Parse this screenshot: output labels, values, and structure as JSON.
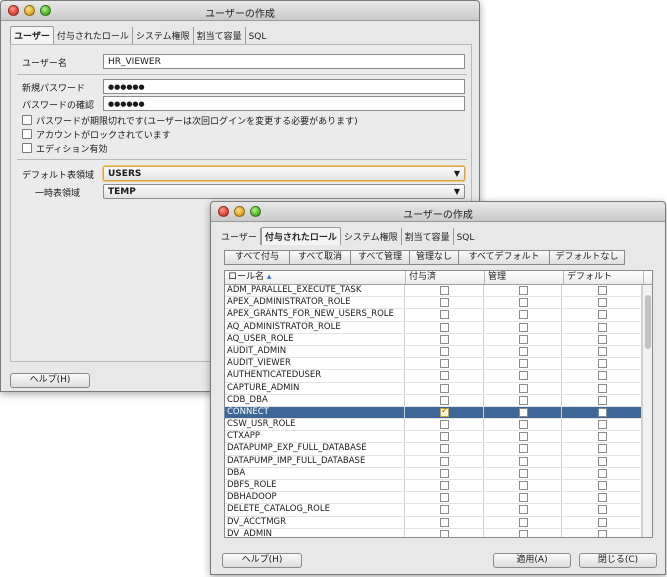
{
  "back_window": {
    "title": "ユーザーの作成",
    "tabs": [
      "ユーザー",
      "付与されたロール",
      "システム権限",
      "割当て容量",
      "SQL"
    ],
    "active_tab": 0,
    "username_label": "ユーザー名",
    "username_value": "HR_VIEWER",
    "new_password_label": "新規パスワード",
    "new_password_value": "●●●●●●",
    "confirm_password_label": "パスワードの確認",
    "confirm_password_value": "●●●●●●",
    "check_expired": "パスワードが期限切れです(ユーザーは次回ログインを変更する必要があります)",
    "check_locked": "アカウントがロックされています",
    "check_edition": "エディション有効",
    "default_ts_label": "デフォルト表領域",
    "default_ts_value": "USERS",
    "temp_ts_label": "一時表領域",
    "temp_ts_value": "TEMP",
    "help_button": "ヘルプ(H)"
  },
  "front_window": {
    "title": "ユーザーの作成",
    "tabs": [
      "ユーザー",
      "付与されたロール",
      "システム権限",
      "割当て容量",
      "SQL"
    ],
    "active_tab": 1,
    "toolbar": [
      "すべて付与",
      "すべて取消",
      "すべて管理",
      "管理なし",
      "すべてデフォルト",
      "デフォルトなし"
    ],
    "columns": [
      "ロール名",
      "付与済",
      "管理",
      "デフォルト"
    ],
    "sort_icon": "sort-ascending-icon",
    "rows": [
      {
        "name": "ADM_PARALLEL_EXECUTE_TASK",
        "granted": false,
        "admin": false,
        "default": false
      },
      {
        "name": "APEX_ADMINISTRATOR_ROLE",
        "granted": false,
        "admin": false,
        "default": false
      },
      {
        "name": "APEX_GRANTS_FOR_NEW_USERS_ROLE",
        "granted": false,
        "admin": false,
        "default": false
      },
      {
        "name": "AQ_ADMINISTRATOR_ROLE",
        "granted": false,
        "admin": false,
        "default": false
      },
      {
        "name": "AQ_USER_ROLE",
        "granted": false,
        "admin": false,
        "default": false
      },
      {
        "name": "AUDIT_ADMIN",
        "granted": false,
        "admin": false,
        "default": false
      },
      {
        "name": "AUDIT_VIEWER",
        "granted": false,
        "admin": false,
        "default": false
      },
      {
        "name": "AUTHENTICATEDUSER",
        "granted": false,
        "admin": false,
        "default": false
      },
      {
        "name": "CAPTURE_ADMIN",
        "granted": false,
        "admin": false,
        "default": false
      },
      {
        "name": "CDB_DBA",
        "granted": false,
        "admin": false,
        "default": false
      },
      {
        "name": "CONNECT",
        "granted": true,
        "admin": false,
        "default": false,
        "selected": true
      },
      {
        "name": "CSW_USR_ROLE",
        "granted": false,
        "admin": false,
        "default": false
      },
      {
        "name": "CTXAPP",
        "granted": false,
        "admin": false,
        "default": false
      },
      {
        "name": "DATAPUMP_EXP_FULL_DATABASE",
        "granted": false,
        "admin": false,
        "default": false
      },
      {
        "name": "DATAPUMP_IMP_FULL_DATABASE",
        "granted": false,
        "admin": false,
        "default": false
      },
      {
        "name": "DBA",
        "granted": false,
        "admin": false,
        "default": false
      },
      {
        "name": "DBFS_ROLE",
        "granted": false,
        "admin": false,
        "default": false
      },
      {
        "name": "DBHADOOP",
        "granted": false,
        "admin": false,
        "default": false
      },
      {
        "name": "DELETE_CATALOG_ROLE",
        "granted": false,
        "admin": false,
        "default": false
      },
      {
        "name": "DV_ACCTMGR",
        "granted": false,
        "admin": false,
        "default": false
      },
      {
        "name": "DV_ADMIN",
        "granted": false,
        "admin": false,
        "default": false
      }
    ],
    "help_button": "ヘルプ(H)",
    "apply_button": "適用(A)",
    "close_button": "閉じる(C)"
  }
}
